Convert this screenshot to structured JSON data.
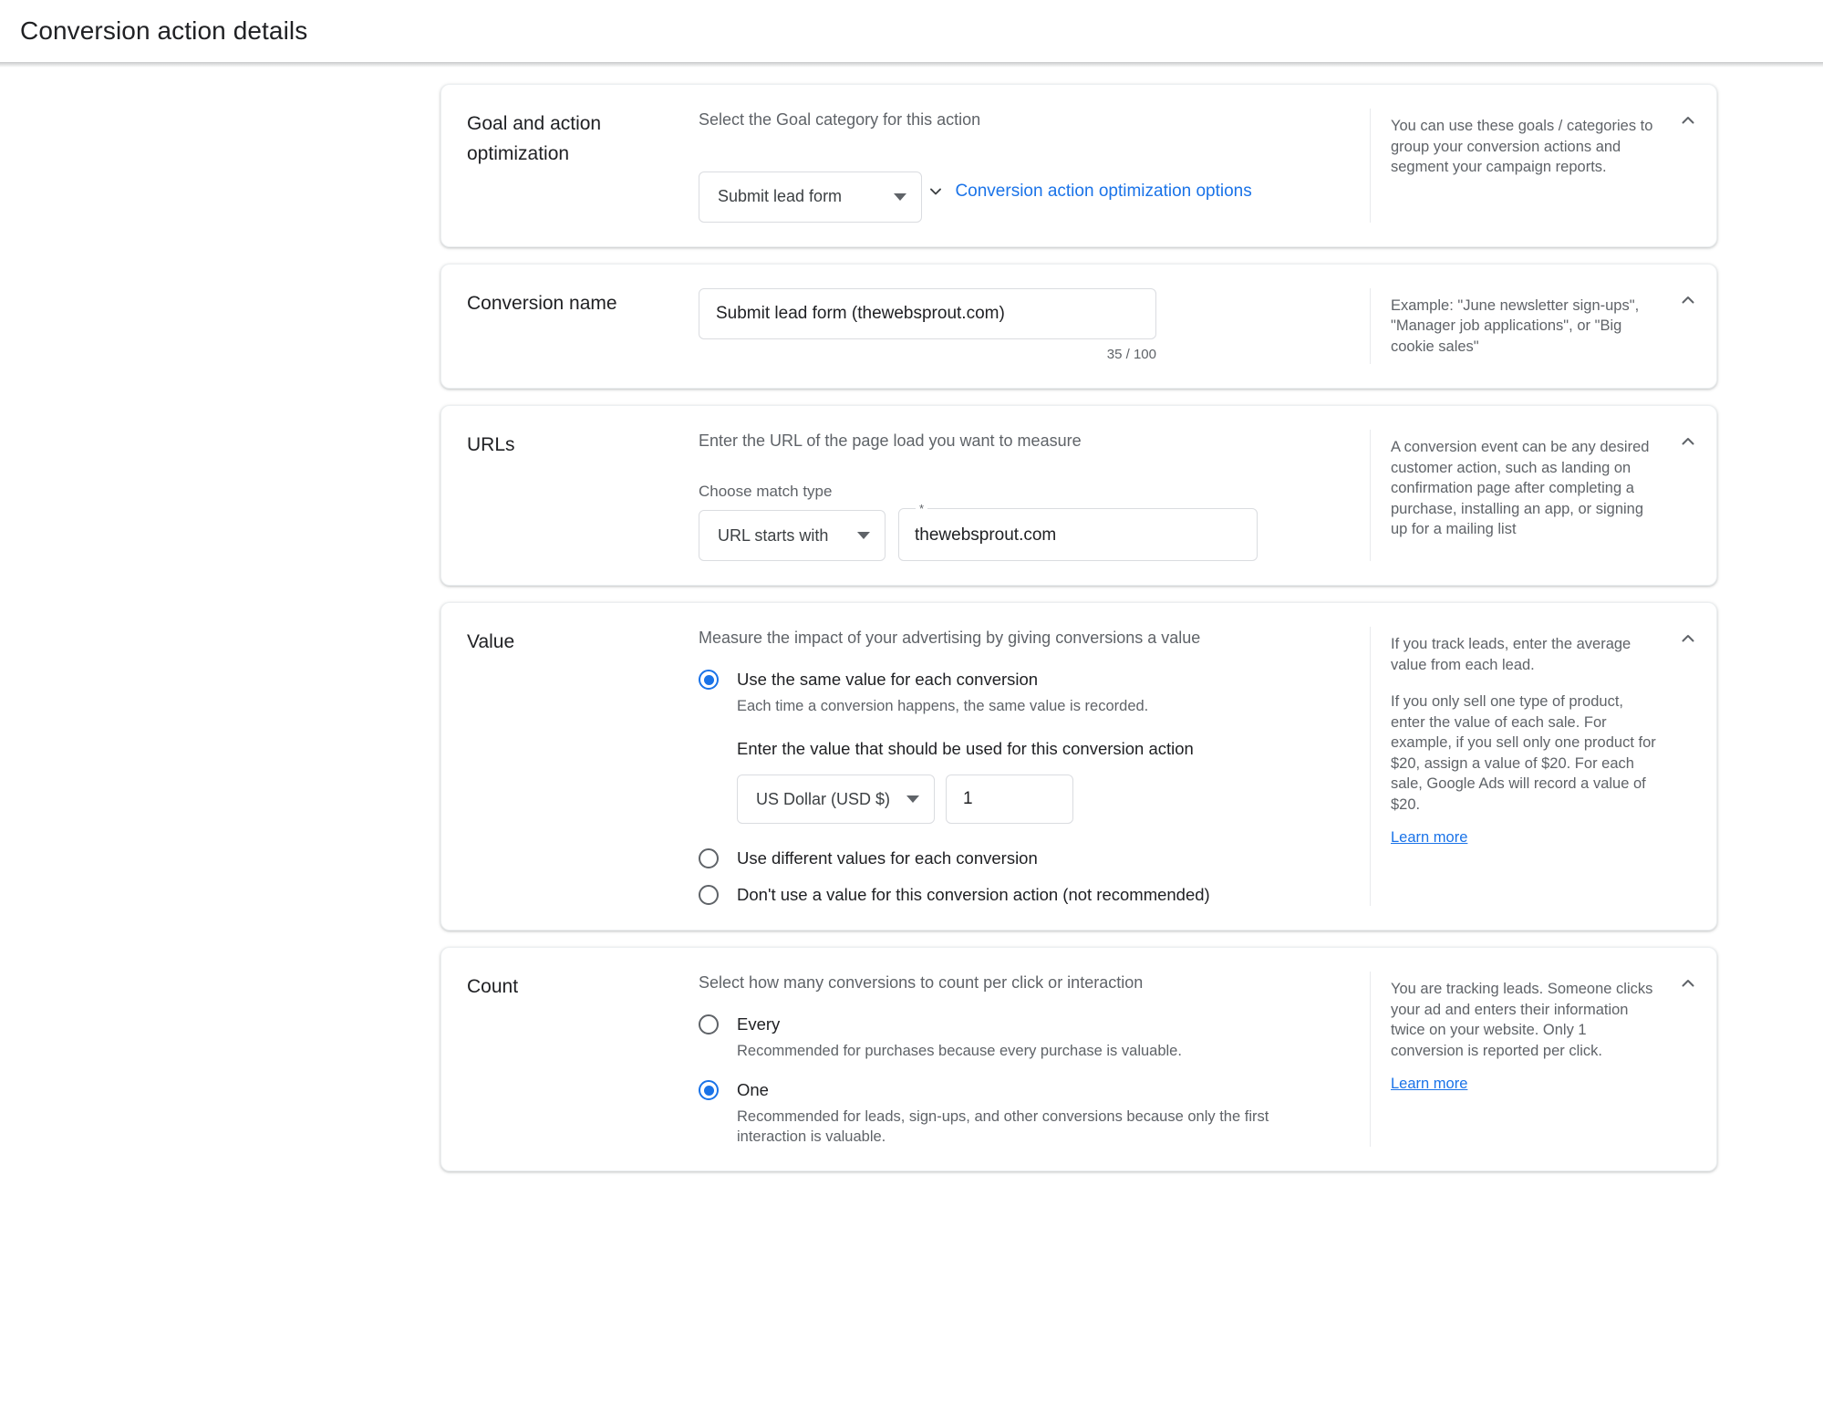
{
  "header": {
    "title": "Conversion action details"
  },
  "icons": {
    "collapse": "chevron-up-icon",
    "expand": "chevron-down-icon",
    "dropdown": "caret-down-icon"
  },
  "colors": {
    "accent": "#1a73e8",
    "text": "#202124",
    "muted": "#5f6368",
    "border": "#dadce0",
    "card_bg": "#ffffff"
  },
  "cards": {
    "goal": {
      "title": "Goal and action optimization",
      "prompt": "Select the Goal category for this action",
      "category_value": "Submit lead form",
      "optimization_link": "Conversion action optimization options",
      "help": [
        "You can use these goals / categories to group your conversion actions and segment your campaign reports."
      ]
    },
    "name": {
      "title": "Conversion name",
      "value": "Submit lead form (thewebsprout.com)",
      "counter": "35 / 100",
      "help": [
        "Example: \"June newsletter sign-ups\", \"Manager job applications\", or \"Big cookie sales\""
      ]
    },
    "urls": {
      "title": "URLs",
      "prompt": "Enter the URL of the page load you want to measure",
      "match_label": "Choose match type",
      "match_value": "URL starts with",
      "url_required_mark": "*",
      "url_value": "thewebsprout.com",
      "help": [
        "A conversion event can be any desired customer action, such as landing on confirmation page after completing a purchase, installing an app, or signing up for a mailing list"
      ]
    },
    "value": {
      "title": "Value",
      "prompt": "Measure the impact of your advertising by giving conversions a value",
      "options": [
        {
          "label": "Use the same value for each conversion",
          "desc": "Each time a conversion happens, the same value is recorded.",
          "selected": true
        },
        {
          "label": "Use different values for each conversion",
          "desc": "",
          "selected": false
        },
        {
          "label": "Don't use a value for this conversion action (not recommended)",
          "desc": "",
          "selected": false
        }
      ],
      "value_prompt": "Enter the value that should be used for this conversion action",
      "currency": "US Dollar (USD $)",
      "amount": "1",
      "help": [
        "If you track leads, enter the average value from each lead.",
        "If you only sell one type of product, enter the value of each sale. For example, if you sell only one product for $20, assign a value of $20. For each sale, Google Ads will record a value of $20."
      ],
      "learn_more": "Learn more"
    },
    "count": {
      "title": "Count",
      "prompt": "Select how many conversions to count per click or interaction",
      "options": [
        {
          "label": "Every",
          "desc": "Recommended for purchases because every purchase is valuable.",
          "selected": false
        },
        {
          "label": "One",
          "desc": "Recommended for leads, sign-ups, and other conversions because only the first interaction is valuable.",
          "selected": true
        }
      ],
      "help": [
        "You are tracking leads. Someone clicks your ad and enters their information twice on your website. Only 1 conversion is reported per click."
      ],
      "learn_more": "Learn more"
    }
  }
}
